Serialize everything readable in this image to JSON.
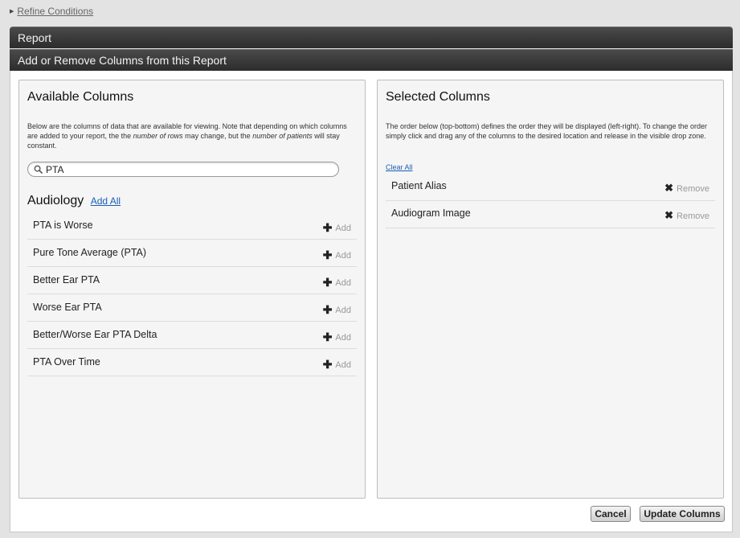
{
  "refine": {
    "label": "Refine Conditions"
  },
  "header": {
    "report": "Report",
    "add_remove": "Add or Remove Columns from this Report"
  },
  "available": {
    "title": "Available Columns",
    "description": {
      "part1": "Below are the columns of data that are available for viewing. Note that depending on which columns are added to your report, the the ",
      "em1": "number of rows",
      "part2": " may change, but the ",
      "em2": "number of patients",
      "part3": " will stay constant."
    },
    "search": {
      "value": "PTA",
      "placeholder": ""
    },
    "section": {
      "title": "Audiology",
      "add_all_label": "Add All",
      "items": [
        {
          "label": "PTA is Worse",
          "action": "Add"
        },
        {
          "label": "Pure Tone Average (PTA)",
          "action": "Add"
        },
        {
          "label": "Better Ear PTA",
          "action": "Add"
        },
        {
          "label": "Worse Ear PTA",
          "action": "Add"
        },
        {
          "label": "Better/Worse Ear PTA Delta",
          "action": "Add"
        },
        {
          "label": "PTA Over Time",
          "action": "Add"
        }
      ]
    }
  },
  "selected": {
    "title": "Selected Columns",
    "description": "The order below (top-bottom) defines the order they will be displayed (left-right). To change the order simply click and drag any of the columns to the desired location and release in the visible drop zone.",
    "clear_all_label": "Clear All",
    "items": [
      {
        "label": "Patient Alias",
        "action": "Remove"
      },
      {
        "label": "Audiogram Image",
        "action": "Remove"
      }
    ]
  },
  "footer": {
    "cancel_label": "Cancel",
    "update_label": "Update Columns"
  },
  "icons": {
    "refine": "triangle-right-icon",
    "search": "search-icon",
    "add": "plus-icon",
    "remove": "close-icon"
  },
  "colors": {
    "header_bar": "#333333",
    "link": "#1a5fb4",
    "panel_bg": "#f5f5f5"
  }
}
